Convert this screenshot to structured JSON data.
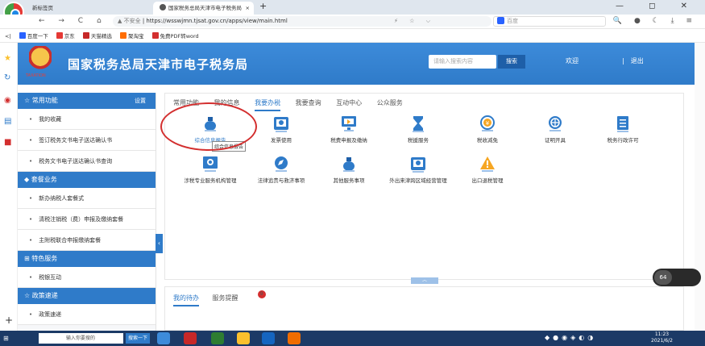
{
  "browser": {
    "tab1": "新标签页",
    "tab2": "国家税务总局天津市电子税务局",
    "tab_close": "×",
    "new_tab": "+",
    "nav_icons": "← → C ⌂ ↺ ☆",
    "security": "▲ 不安全",
    "url": "https://wsswjmn.tjsat.gov.cn/apps/view/main.html",
    "search_placeholder": "百度",
    "window_controls": "— ◻ ✕"
  },
  "bookmarks": [
    {
      "label": "百度一下",
      "color": "#2962ff"
    },
    {
      "label": "京东",
      "color": "#e53935"
    },
    {
      "label": "天猫精选",
      "color": "#c62828"
    },
    {
      "label": "聚淘宝",
      "color": "#ff6d00"
    },
    {
      "label": "免费PDF转word",
      "color": "#d32f2f"
    }
  ],
  "header": {
    "emblem_text": "TAXATION",
    "title": "国家税务总局天津市电子税务局",
    "search_placeholder": "请输入搜索内容",
    "search_button": "搜索",
    "welcome": "欢迎",
    "logout": "退出"
  },
  "menu": {
    "section_common": "常用功能",
    "settings": "设置",
    "common_items": [
      "我的收藏",
      "签订税务文书电子送达确认书",
      "税务文书电子送达确认书查询"
    ],
    "section_package": "套餐业务",
    "package_items": [
      "新办纳税人套餐式",
      "清税注销税（费）申报及缴纳套餐",
      "主附税联合申报缴纳套餐"
    ],
    "section_special": "特色服务",
    "special_items": [
      "税银互动"
    ],
    "section_policy": "政策速递",
    "policy_items": [
      "政策速递"
    ]
  },
  "tabs": [
    "常用功能",
    "我的信息",
    "我要办税",
    "我要查询",
    "互动中心",
    "公众服务"
  ],
  "services": [
    {
      "label": "综合信息报告",
      "icon": "bag-icon"
    },
    {
      "label": "发票使用",
      "icon": "invoice-icon"
    },
    {
      "label": "税费申报及缴纳",
      "icon": "monitor-icon"
    },
    {
      "label": "税援服务",
      "icon": "hourglass-icon"
    },
    {
      "label": "税收减免",
      "icon": "yuan-cycle-icon"
    },
    {
      "label": "证明开具",
      "icon": "globe-icon"
    },
    {
      "label": "税务行政许可",
      "icon": "document-icon"
    },
    {
      "label": "涉税专业服务机构管理",
      "icon": "screen-icon"
    },
    {
      "label": "法律追责与救济事项",
      "icon": "compass-icon"
    },
    {
      "label": "其他服务事项",
      "icon": "bag-icon"
    },
    {
      "label": "外出来津跨区域经营管理",
      "icon": "invoice-icon"
    },
    {
      "label": "出口退税管理",
      "icon": "warning-icon"
    }
  ],
  "tooltip": "综合信息报告",
  "bottom_tabs": {
    "todo": "我的待办",
    "reminder": "服务提醒",
    "badge": "9"
  },
  "speed": "64",
  "taskbar": {
    "search_text": "输入你要搜的",
    "search_button": "搜索一下",
    "time": "11:23",
    "date": "2021/6/2"
  }
}
